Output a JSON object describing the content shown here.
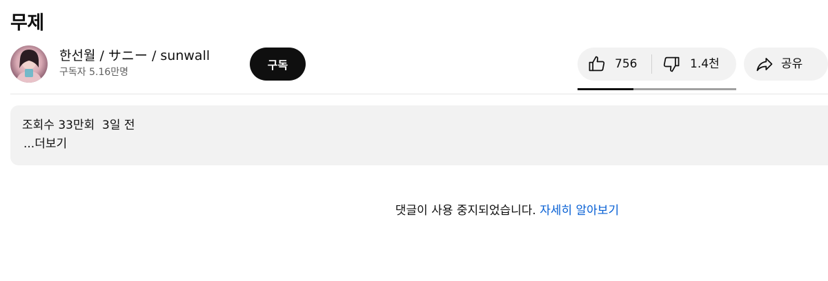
{
  "video": {
    "title": "무제"
  },
  "channel": {
    "name": "한선월 / サニー / sunwall",
    "subscribers": "구독자 5.16만명",
    "avatar_icon": "channel-avatar"
  },
  "actions": {
    "subscribe_label": "구독",
    "like_count": "756",
    "dislike_count": "1.4천",
    "share_label": "공유",
    "like_ratio": 0.35,
    "like_icon": "thumbs-up-icon",
    "dislike_icon": "thumbs-down-icon",
    "share_icon": "share-arrow-icon"
  },
  "description": {
    "meta": "조회수 33만회  3일 전",
    "more_label": "...더보기"
  },
  "comments": {
    "disabled_text": "댓글이 사용 중지되었습니다.",
    "learn_more_label": "자세히 알아보기",
    "link_color": "#065fd4"
  }
}
